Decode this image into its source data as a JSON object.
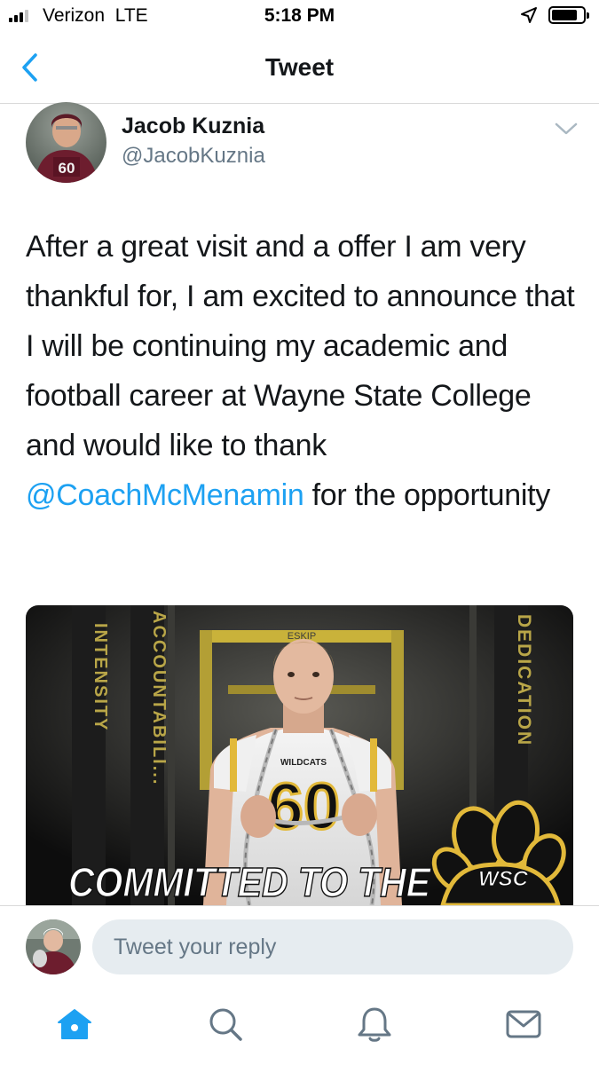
{
  "status_bar": {
    "carrier": "Verizon",
    "network": "LTE",
    "time": "5:18 PM"
  },
  "nav": {
    "title": "Tweet",
    "back_icon": "chevron-left-icon"
  },
  "tweet": {
    "author_name": "Jacob Kuznia",
    "author_handle": "@JacobKuznia",
    "text_before": "After a great visit and a offer I am very thankful for, I am excited to announce that I will be continuing my academic and football career at Wayne State College and would like to thank ",
    "mention": "@CoachMcMenamin",
    "text_after": " for the opportunity",
    "media": {
      "banner_left_1": "INTENSITY",
      "banner_left_2": "ACCOUNTABILI...",
      "banner_right": "DEDICATION",
      "jersey_team": "WILDCATS",
      "jersey_number": "60",
      "headline": "COMMITTED TO THE",
      "logo_text": "WSC",
      "rack_text": "ESKIP"
    }
  },
  "reply": {
    "placeholder": "Tweet your reply"
  },
  "tabs": [
    {
      "name": "home-icon",
      "active": true
    },
    {
      "name": "search-icon",
      "active": false
    },
    {
      "name": "notifications-icon",
      "active": false
    },
    {
      "name": "messages-icon",
      "active": false
    }
  ],
  "colors": {
    "accent": "#1da1f2",
    "text": "#14171a",
    "secondary": "#657786",
    "input_bg": "#e6ecf0"
  }
}
